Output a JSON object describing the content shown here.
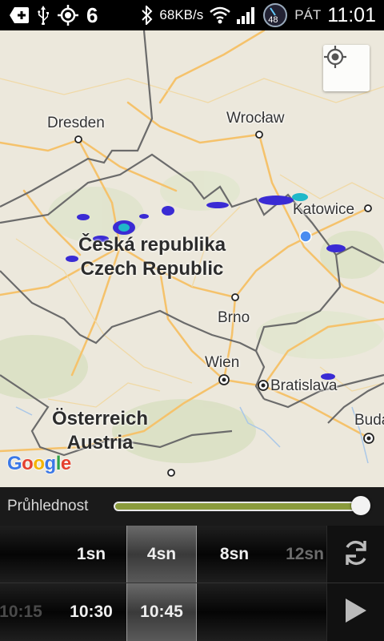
{
  "status_bar": {
    "notification_count": "6",
    "network_speed": "68KB/s",
    "speed_badge": "48",
    "day": "PÁT",
    "time": "11:01"
  },
  "map": {
    "places": {
      "dresden": "Dresden",
      "wroclaw": "Wrocław",
      "katowice": "Katowice",
      "brno": "Brno",
      "wien": "Wien",
      "bratislava": "Bratislava",
      "budapest": "Budape"
    },
    "countries": {
      "czech_local": "Česká republika",
      "czech_en": "Czech Republic",
      "austria_local": "Österreich",
      "austria_en": "Austria"
    },
    "logo": [
      "G",
      "o",
      "o",
      "g",
      "l",
      "e"
    ],
    "colors": {
      "land": "#ece8dc",
      "road": "#f5c26b",
      "border": "#6b6b6b",
      "radar": "#3a2bd4",
      "location_dot": "#4a8cf0"
    }
  },
  "transparency": {
    "label": "Průhlednost",
    "value": 0.97
  },
  "timespan_options": [
    {
      "label": "1sn",
      "state": "normal"
    },
    {
      "label": "4sn",
      "state": "selected"
    },
    {
      "label": "8sn",
      "state": "normal"
    },
    {
      "label": "12sn",
      "state": "dim"
    }
  ],
  "time_options": [
    {
      "label": "10:15",
      "state": "faint"
    },
    {
      "label": "10:30",
      "state": "normal"
    },
    {
      "label": "10:45",
      "state": "selected"
    }
  ],
  "icons": {
    "refresh": "refresh-icon",
    "play": "play-icon",
    "locate": "my-location-icon"
  }
}
